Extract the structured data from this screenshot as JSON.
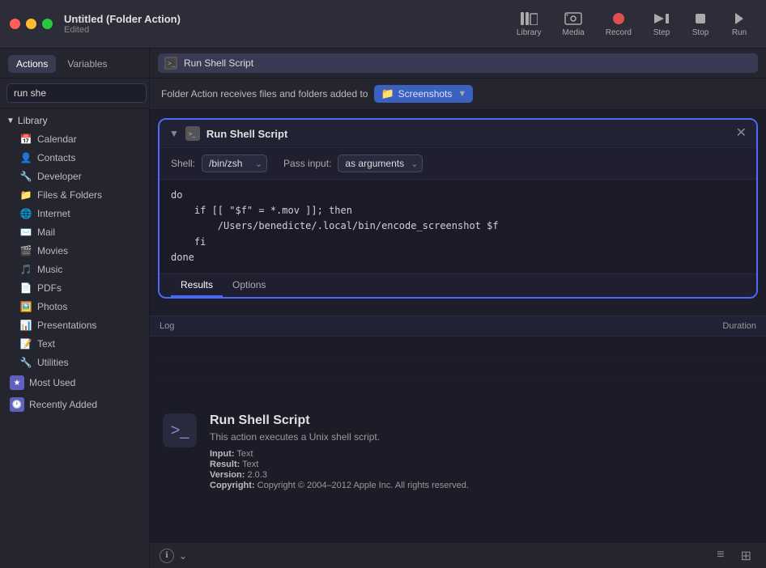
{
  "titlebar": {
    "app_title": "Untitled (Folder Action)",
    "app_subtitle": "Edited",
    "traffic_lights": [
      "red",
      "yellow",
      "green"
    ]
  },
  "toolbar": {
    "library_label": "Library",
    "media_label": "Media",
    "record_label": "Record",
    "step_label": "Step",
    "stop_label": "Stop",
    "run_label": "Run"
  },
  "sidebar": {
    "tabs": [
      {
        "id": "actions",
        "label": "Actions"
      },
      {
        "id": "variables",
        "label": "Variables"
      }
    ],
    "search_placeholder": "run she",
    "library_section": {
      "label": "Library",
      "items": [
        {
          "id": "calendar",
          "label": "Calendar",
          "icon": "📅"
        },
        {
          "id": "contacts",
          "label": "Contacts",
          "icon": "👤"
        },
        {
          "id": "developer",
          "label": "Developer",
          "icon": "🔧"
        },
        {
          "id": "files-folders",
          "label": "Files & Folders",
          "icon": "📁"
        },
        {
          "id": "internet",
          "label": "Internet",
          "icon": "🌐"
        },
        {
          "id": "mail",
          "label": "Mail",
          "icon": "✉️"
        },
        {
          "id": "movies",
          "label": "Movies",
          "icon": "🎬"
        },
        {
          "id": "music",
          "label": "Music",
          "icon": "🎵"
        },
        {
          "id": "pdfs",
          "label": "PDFs",
          "icon": "📄"
        },
        {
          "id": "photos",
          "label": "Photos",
          "icon": "🖼️"
        },
        {
          "id": "presentations",
          "label": "Presentations",
          "icon": "📊"
        },
        {
          "id": "text",
          "label": "Text",
          "icon": "📝"
        },
        {
          "id": "utilities",
          "label": "Utilities",
          "icon": "🔧"
        }
      ]
    },
    "most_used": {
      "label": "Most Used"
    },
    "recently_added": {
      "label": "Recently Added"
    }
  },
  "search_results": {
    "item": "Run Shell Script"
  },
  "folder_action_bar": {
    "prefix_text": "Folder Action receives files and folders added to",
    "folder_label": "Screenshots"
  },
  "script_panel": {
    "title": "Run Shell Script",
    "shell_label": "Shell:",
    "shell_value": "/bin/zsh",
    "pass_input_label": "Pass input:",
    "pass_input_value": "as arguments",
    "code": "do\n    if [[ \"$f\" = *.mov ]]; then\n        /Users/benedicte/.local/bin/encode_screenshot $f\n    fi\ndone",
    "tabs": [
      {
        "id": "results",
        "label": "Results"
      },
      {
        "id": "options",
        "label": "Options"
      }
    ]
  },
  "log_section": {
    "col_log": "Log",
    "col_duration": "Duration",
    "rows": []
  },
  "bottom_panel": {
    "icon": ">_",
    "title": "Run Shell Script",
    "description": "This action executes a Unix shell script.",
    "input_label": "Input:",
    "input_value": "Text",
    "result_label": "Result:",
    "result_value": "Text",
    "version_label": "Version:",
    "version_value": "2.0.3",
    "copyright_label": "Copyright:",
    "copyright_value": "Copyright © 2004–2012 Apple Inc. All rights reserved."
  },
  "status_bar": {
    "info_icon": "ℹ",
    "dropdown_label": "",
    "list_icon": "≡",
    "grid_icon": "⊞"
  }
}
